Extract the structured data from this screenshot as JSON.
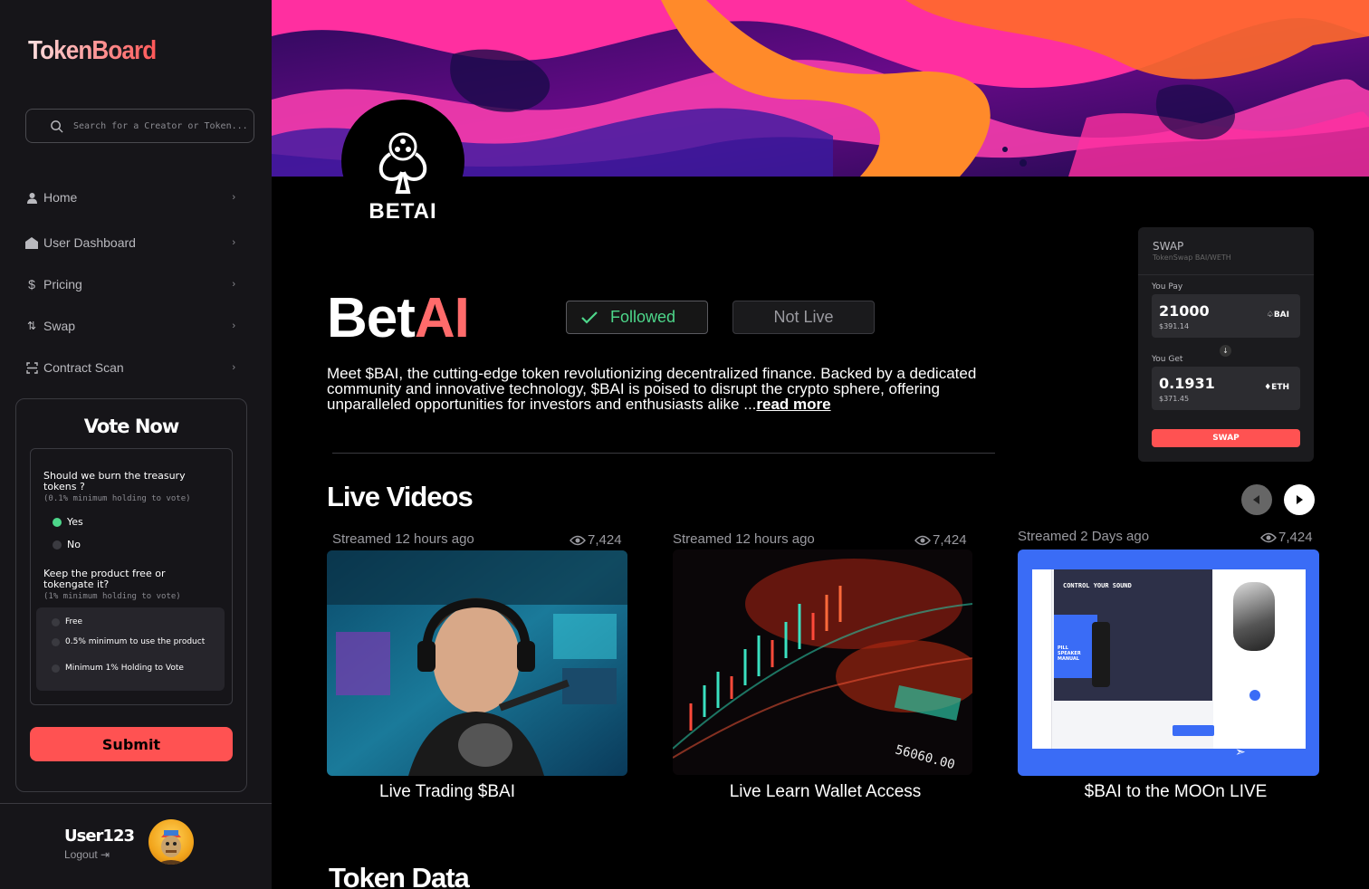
{
  "app": {
    "brand": "TokenBoard"
  },
  "search": {
    "placeholder": "Search for a Creator or Token..."
  },
  "nav": [
    {
      "label": "Home",
      "icon": "user-icon"
    },
    {
      "label": "User Dashboard",
      "icon": "home-icon"
    },
    {
      "label": "Pricing",
      "icon": "dollar-icon"
    },
    {
      "label": "Swap",
      "icon": "swap-icon"
    },
    {
      "label": "Contract Scan",
      "icon": "scan-icon"
    }
  ],
  "vote": {
    "title": "Vote Now",
    "q1": {
      "text": "Should we burn the treasury tokens ?",
      "sub": "(0.1% minimum holding to vote)",
      "options": [
        "Yes",
        "No"
      ],
      "selected": "Yes"
    },
    "q2": {
      "text": "Keep the product free or tokengate it?",
      "sub": "(1% minimum holding to vote)",
      "options": [
        "Free",
        "0.5% minimum to use the product",
        "Minimum 1% Holding to Vote"
      ]
    },
    "submit": "Submit"
  },
  "user": {
    "name": "User123",
    "logout": "Logout"
  },
  "token": {
    "logo_text": "BETAI",
    "name_part1": "Bet",
    "name_part2": "AI",
    "followed": "Followed",
    "not_live": "Not Live",
    "description": "Meet $BAI, the cutting-edge token revolutionizing decentralized finance. Backed by a dedicated community and innovative technology, $BAI is poised to disrupt the crypto sphere, offering unparalleled opportunities for investors and enthusiasts alike ...",
    "read_more": "read more"
  },
  "swap": {
    "title": "SWAP",
    "subtitle": "TokenSwap BAI/WETH",
    "pay_label": "You Pay",
    "pay_amount": "21000",
    "pay_usd": "$391.14",
    "pay_token": "BAI",
    "get_label": "You Get",
    "get_amount": "0.1931",
    "get_usd": "$371.45",
    "get_token": "ETH",
    "button": "SWAP"
  },
  "live": {
    "title": "Live Videos",
    "videos": [
      {
        "streamed": "Streamed 12 hours ago",
        "views": "7,424",
        "caption": "Live Trading $BAI"
      },
      {
        "streamed": "Streamed 12 hours ago",
        "views": "7,424",
        "caption": "Live Learn Wallet Access"
      },
      {
        "streamed": "Streamed 2 Days ago",
        "views": "7,424",
        "caption": "$BAI to the MOOn LIVE"
      }
    ],
    "thumb3": {
      "heading": "CONTROL YOUR SOUND",
      "side_label": "PILL SPEAKER MANUAL"
    }
  },
  "token_data": {
    "title": "Token Data"
  },
  "colors": {
    "accent": "#ff5252",
    "green": "#4dd68a",
    "sidebar": "#161519"
  }
}
